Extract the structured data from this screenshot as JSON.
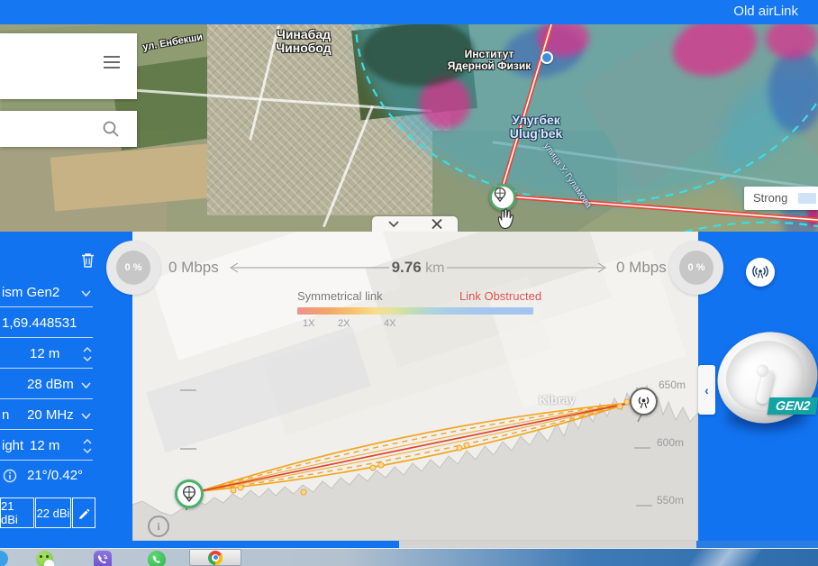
{
  "topbar": {
    "title": "Old airLink"
  },
  "map": {
    "town1": "Чинабад",
    "town2": "Чинобод",
    "institute1": "Институт",
    "institute2": "Ядерной Физик",
    "ulugbek1": "Улугбек",
    "ulugbek2": "Ulug'bek",
    "street_enbekshi": "ул. Енбекши",
    "street_gulamova": "улица У. Гуламова",
    "strong": "Strong"
  },
  "sidebar": {
    "device": "ism Gen2",
    "coords": "1,69.448531",
    "antenna_height": "12 m",
    "power": "28 dBm",
    "channel_label_fragment": "n",
    "channel_width": "20 MHz",
    "height_label_fragment": "ight",
    "height": "12 m",
    "tilt": "21°/0.42°",
    "gain_left": "21 dBi",
    "gain_right": "22 dBi"
  },
  "panel": {
    "rate_left": "0 Mbps",
    "rate_right": "0 Mbps",
    "pct_left": "0 %",
    "pct_right": "0 %",
    "distance": "9.76",
    "distance_unit": "km",
    "symmetrical": "Symmetrical link",
    "obstructed": "Link Obstructed",
    "scale": [
      "1X",
      "2X",
      "4X"
    ],
    "grid": [
      "650m",
      "600m",
      "550m"
    ],
    "kibray": "Kibray",
    "info_glyph": "i"
  },
  "product": {
    "badge": "GEN2"
  },
  "icons": {
    "hamburger": "menu",
    "search": "magnifier",
    "trash": "delete-link",
    "chevron-down": "select-open",
    "stepper": "value-up-down",
    "close": "close-panel",
    "collapse": "collapse-panel",
    "broadcast": "access-point",
    "dish": "antenna-site",
    "info": "tooltip-info",
    "pencil": "edit-antenna",
    "hand": "map-drag-cursor"
  },
  "colors": {
    "accent_blue": "#1273f0",
    "link_red": "#e8473b",
    "fresnel_orange": "#f2a51f",
    "obstructed_red": "#e05252",
    "marker_green": "#4db06b",
    "badge_teal": "#12a3a3"
  }
}
